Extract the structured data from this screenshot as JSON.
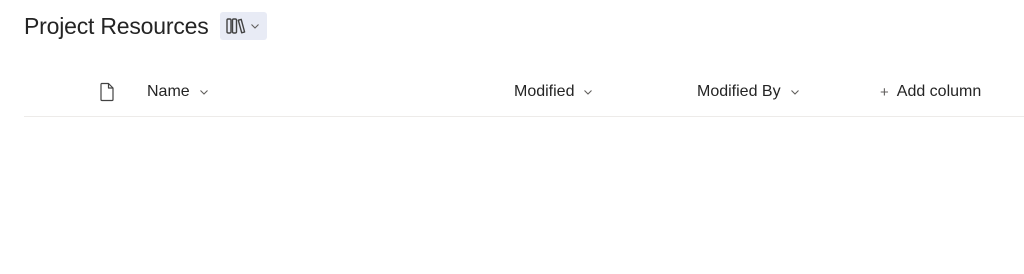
{
  "library": {
    "title": "Project Resources",
    "view_switcher_icon": "library-icon",
    "view_switcher_chevron": "chevron-down-icon"
  },
  "columns": {
    "type_icon": "document-icon",
    "name_label": "Name",
    "modified_label": "Modified",
    "modified_by_label": "Modified By",
    "add_column_label": "Add column",
    "add_column_icon": "+"
  },
  "colors": {
    "text": "#242424",
    "switcher_background": "#e8ebf5",
    "divider": "#edebe9",
    "chevron": "#605e5c"
  }
}
